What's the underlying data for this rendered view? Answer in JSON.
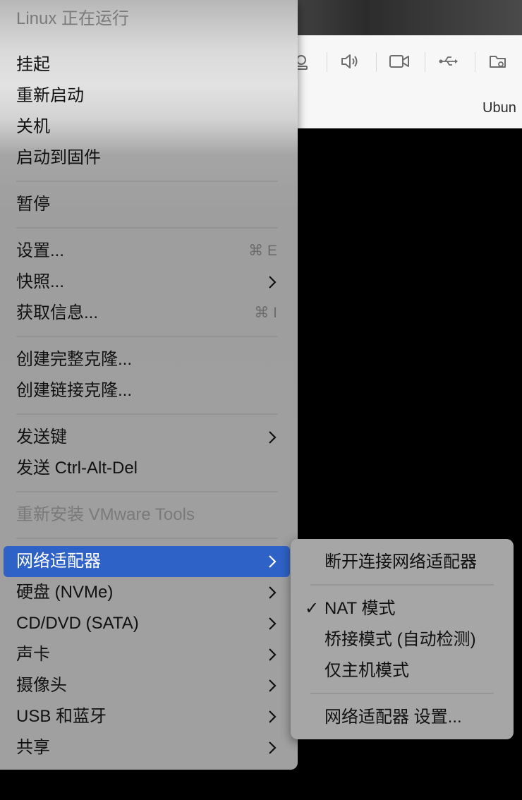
{
  "vm_window": {
    "tab_label": "Ubun"
  },
  "toolbar_icons": [
    "camera-icon",
    "speaker-icon",
    "video-camera-icon",
    "usb-icon",
    "shared-folder-icon"
  ],
  "menu": {
    "status": "Linux 正在运行",
    "items": {
      "suspend": "挂起",
      "restart": "重新启动",
      "shutdown": "关机",
      "boot_firmware": "启动到固件",
      "pause": "暂停",
      "settings": "设置...",
      "settings_shortcut": "⌘ E",
      "snapshots": "快照...",
      "get_info": "获取信息...",
      "get_info_shortcut": "⌘ I",
      "full_clone": "创建完整克隆...",
      "linked_clone": "创建链接克隆...",
      "send_key": "发送键",
      "send_cad": "发送 Ctrl-Alt-Del",
      "reinstall_tools": "重新安装 VMware Tools",
      "network_adapter": "网络适配器",
      "hard_disk": "硬盘 (NVMe)",
      "cd_dvd": "CD/DVD (SATA)",
      "sound_card": "声卡",
      "camera": "摄像头",
      "usb_bluetooth": "USB 和蓝牙",
      "sharing": "共享"
    }
  },
  "submenu": {
    "disconnect": "断开连接网络适配器",
    "nat": "NAT 模式",
    "nat_check": "✓",
    "bridged": "桥接模式 (自动检测)",
    "host_only": "仅主机模式",
    "adapter_settings": "网络适配器 设置..."
  },
  "colors": {
    "highlight": "#2f62c6"
  }
}
